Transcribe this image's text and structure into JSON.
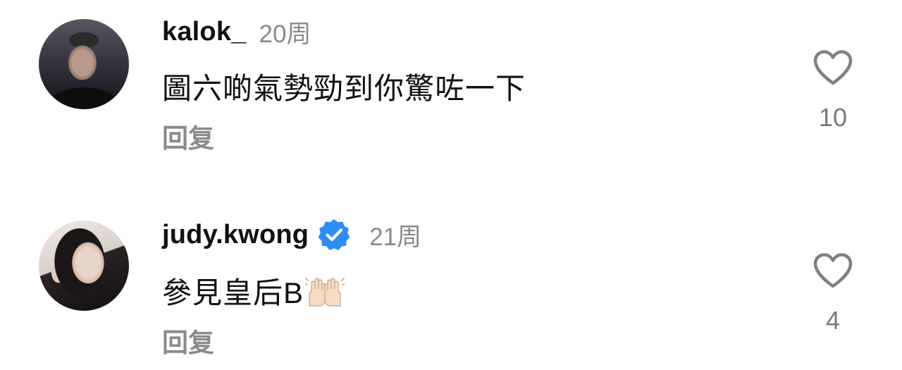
{
  "comments": [
    {
      "username": "kalok_",
      "time": "20周",
      "verified": false,
      "text": "圖六啲氣勢勁到你驚咗一下",
      "reply_label": "回复",
      "likes": "10",
      "avatar": "user-photo-avatar"
    },
    {
      "username": "judy.kwong",
      "time": "21周",
      "verified": true,
      "text": "參見皇后B",
      "emoji": "raising-hands-emoji",
      "reply_label": "回复",
      "likes": "4",
      "avatar": "user-photo-avatar"
    }
  ],
  "colors": {
    "username": "#111111",
    "timestamp": "#8a8a8a",
    "reply": "#8a8a8a",
    "like_count": "#7a7a7a",
    "verified_badge": "#2f8cf2",
    "heart_outline": "#808080"
  },
  "icons": {
    "like": "heart-outline-icon",
    "verified": "verified-check-badge-icon"
  }
}
